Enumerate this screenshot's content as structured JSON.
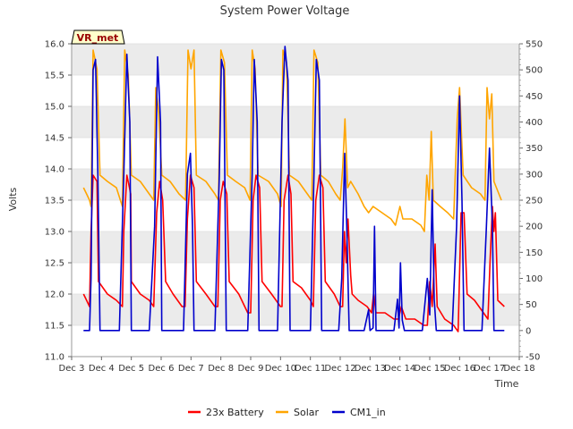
{
  "chart_data": {
    "type": "line",
    "title": "System Power Voltage",
    "site_label": "VR_met",
    "xlabel": "Time",
    "ylabel": "Volts",
    "x_categories": [
      "Dec 3",
      "Dec 4",
      "Dec 5",
      "Dec 6",
      "Dec 7",
      "Dec 8",
      "Dec 9",
      "Dec 10",
      "Dec 11",
      "Dec 12",
      "Dec 13",
      "Dec 14",
      "Dec 15",
      "Dec 16",
      "Dec 17",
      "Dec 18"
    ],
    "xlim": [
      3,
      18
    ],
    "ylim_left": [
      11.0,
      16.0
    ],
    "yticks_left": [
      "11.0",
      "11.5",
      "12.0",
      "12.5",
      "13.0",
      "13.5",
      "14.0",
      "14.5",
      "15.0",
      "15.5",
      "16.0"
    ],
    "ylim_right": [
      -50,
      550
    ],
    "yticks_right": [
      "-50",
      "0",
      "50",
      "100",
      "150",
      "200",
      "250",
      "300",
      "350",
      "400",
      "450",
      "500",
      "550"
    ],
    "grid": "horizontal bands",
    "legend_position": "bottom",
    "series": [
      {
        "name": "23x Battery",
        "color": "#ff0000",
        "axis": "left",
        "points": [
          [
            3.4,
            12.0
          ],
          [
            3.5,
            11.9
          ],
          [
            3.6,
            11.8
          ],
          [
            3.65,
            13.0
          ],
          [
            3.72,
            13.9
          ],
          [
            3.85,
            13.8
          ],
          [
            3.9,
            12.2
          ],
          [
            4.2,
            12.0
          ],
          [
            4.5,
            11.9
          ],
          [
            4.7,
            11.8
          ],
          [
            4.75,
            13.0
          ],
          [
            4.85,
            13.9
          ],
          [
            4.98,
            13.6
          ],
          [
            5.0,
            12.2
          ],
          [
            5.3,
            12.0
          ],
          [
            5.6,
            11.9
          ],
          [
            5.75,
            11.8
          ],
          [
            5.85,
            13.3
          ],
          [
            5.95,
            13.8
          ],
          [
            6.05,
            13.5
          ],
          [
            6.15,
            12.2
          ],
          [
            6.4,
            12.0
          ],
          [
            6.7,
            11.8
          ],
          [
            6.8,
            11.8
          ],
          [
            6.88,
            13.2
          ],
          [
            6.98,
            13.9
          ],
          [
            7.1,
            13.7
          ],
          [
            7.18,
            12.2
          ],
          [
            7.5,
            12.0
          ],
          [
            7.8,
            11.8
          ],
          [
            7.9,
            11.8
          ],
          [
            7.98,
            13.5
          ],
          [
            8.08,
            13.8
          ],
          [
            8.2,
            13.6
          ],
          [
            8.28,
            12.2
          ],
          [
            8.6,
            12.0
          ],
          [
            8.9,
            11.7
          ],
          [
            9.0,
            11.7
          ],
          [
            9.08,
            13.5
          ],
          [
            9.18,
            13.9
          ],
          [
            9.3,
            13.7
          ],
          [
            9.38,
            12.2
          ],
          [
            9.7,
            12.0
          ],
          [
            10.0,
            11.8
          ],
          [
            10.05,
            11.8
          ],
          [
            10.12,
            13.5
          ],
          [
            10.25,
            13.9
          ],
          [
            10.35,
            13.6
          ],
          [
            10.42,
            12.2
          ],
          [
            10.7,
            12.1
          ],
          [
            11.0,
            11.9
          ],
          [
            11.1,
            11.8
          ],
          [
            11.18,
            13.5
          ],
          [
            11.3,
            13.9
          ],
          [
            11.42,
            13.7
          ],
          [
            11.5,
            12.2
          ],
          [
            11.8,
            12.0
          ],
          [
            12.0,
            11.8
          ],
          [
            12.08,
            11.8
          ],
          [
            12.14,
            13.0
          ],
          [
            12.2,
            12.5
          ],
          [
            12.26,
            13.2
          ],
          [
            12.35,
            12.3
          ],
          [
            12.4,
            12.0
          ],
          [
            12.6,
            11.9
          ],
          [
            12.9,
            11.8
          ],
          [
            13.05,
            11.7
          ],
          [
            13.12,
            12.0
          ],
          [
            13.2,
            11.7
          ],
          [
            13.5,
            11.7
          ],
          [
            13.8,
            11.6
          ],
          [
            13.95,
            11.6
          ],
          [
            14.05,
            11.8
          ],
          [
            14.12,
            11.7
          ],
          [
            14.2,
            11.6
          ],
          [
            14.5,
            11.6
          ],
          [
            14.8,
            11.5
          ],
          [
            14.92,
            11.5
          ],
          [
            15.0,
            12.2
          ],
          [
            15.08,
            11.8
          ],
          [
            15.18,
            12.8
          ],
          [
            15.25,
            11.8
          ],
          [
            15.5,
            11.6
          ],
          [
            15.8,
            11.5
          ],
          [
            15.95,
            11.4
          ],
          [
            16.05,
            13.3
          ],
          [
            16.15,
            13.3
          ],
          [
            16.25,
            12.0
          ],
          [
            16.5,
            11.9
          ],
          [
            16.8,
            11.7
          ],
          [
            16.95,
            11.6
          ],
          [
            17.02,
            12.5
          ],
          [
            17.1,
            13.4
          ],
          [
            17.15,
            13.0
          ],
          [
            17.2,
            13.3
          ],
          [
            17.28,
            11.9
          ],
          [
            17.5,
            11.8
          ]
        ]
      },
      {
        "name": "Solar",
        "color": "#ffa500",
        "axis": "left",
        "points": [
          [
            3.4,
            13.7
          ],
          [
            3.5,
            13.6
          ],
          [
            3.6,
            13.5
          ],
          [
            3.65,
            13.4
          ],
          [
            3.72,
            15.9
          ],
          [
            3.85,
            15.6
          ],
          [
            3.95,
            13.9
          ],
          [
            4.2,
            13.8
          ],
          [
            4.5,
            13.7
          ],
          [
            4.7,
            13.4
          ],
          [
            4.78,
            15.9
          ],
          [
            4.9,
            15.5
          ],
          [
            5.0,
            13.9
          ],
          [
            5.3,
            13.8
          ],
          [
            5.6,
            13.6
          ],
          [
            5.75,
            13.5
          ],
          [
            5.82,
            15.3
          ],
          [
            5.92,
            14.9
          ],
          [
            6.02,
            13.9
          ],
          [
            6.3,
            13.8
          ],
          [
            6.6,
            13.6
          ],
          [
            6.82,
            13.5
          ],
          [
            6.9,
            15.9
          ],
          [
            7.0,
            15.6
          ],
          [
            7.1,
            15.9
          ],
          [
            7.18,
            13.9
          ],
          [
            7.5,
            13.8
          ],
          [
            7.8,
            13.6
          ],
          [
            7.92,
            13.5
          ],
          [
            8.0,
            15.9
          ],
          [
            8.12,
            15.7
          ],
          [
            8.22,
            13.9
          ],
          [
            8.5,
            13.8
          ],
          [
            8.8,
            13.7
          ],
          [
            8.98,
            13.5
          ],
          [
            9.05,
            15.9
          ],
          [
            9.15,
            15.6
          ],
          [
            9.25,
            13.9
          ],
          [
            9.6,
            13.8
          ],
          [
            9.9,
            13.6
          ],
          [
            10.02,
            13.4
          ],
          [
            10.08,
            15.9
          ],
          [
            10.2,
            15.7
          ],
          [
            10.3,
            13.9
          ],
          [
            10.6,
            13.8
          ],
          [
            10.9,
            13.6
          ],
          [
            11.05,
            13.5
          ],
          [
            11.12,
            15.9
          ],
          [
            11.25,
            15.7
          ],
          [
            11.35,
            13.9
          ],
          [
            11.6,
            13.8
          ],
          [
            11.85,
            13.6
          ],
          [
            12.0,
            13.5
          ],
          [
            12.08,
            14.0
          ],
          [
            12.16,
            14.8
          ],
          [
            12.25,
            13.7
          ],
          [
            12.35,
            13.8
          ],
          [
            12.6,
            13.6
          ],
          [
            12.8,
            13.4
          ],
          [
            12.95,
            13.3
          ],
          [
            13.1,
            13.4
          ],
          [
            13.4,
            13.3
          ],
          [
            13.7,
            13.2
          ],
          [
            13.85,
            13.1
          ],
          [
            14.0,
            13.4
          ],
          [
            14.1,
            13.2
          ],
          [
            14.4,
            13.2
          ],
          [
            14.7,
            13.1
          ],
          [
            14.82,
            13.0
          ],
          [
            14.9,
            13.9
          ],
          [
            14.98,
            13.5
          ],
          [
            15.05,
            14.6
          ],
          [
            15.12,
            13.5
          ],
          [
            15.35,
            13.4
          ],
          [
            15.6,
            13.3
          ],
          [
            15.8,
            13.2
          ],
          [
            15.92,
            14.8
          ],
          [
            16.0,
            15.3
          ],
          [
            16.12,
            13.9
          ],
          [
            16.4,
            13.7
          ],
          [
            16.7,
            13.6
          ],
          [
            16.85,
            13.5
          ],
          [
            16.92,
            15.3
          ],
          [
            17.0,
            14.8
          ],
          [
            17.08,
            15.2
          ],
          [
            17.15,
            13.8
          ],
          [
            17.4,
            13.5
          ]
        ]
      },
      {
        "name": "CM1_in",
        "color": "#0000cc",
        "axis": "right",
        "points": [
          [
            3.4,
            0
          ],
          [
            3.6,
            0
          ],
          [
            3.65,
            100
          ],
          [
            3.72,
            500
          ],
          [
            3.8,
            520
          ],
          [
            3.88,
            300
          ],
          [
            3.95,
            0
          ],
          [
            4.6,
            0
          ],
          [
            4.75,
            300
          ],
          [
            4.85,
            530
          ],
          [
            4.95,
            400
          ],
          [
            5.0,
            0
          ],
          [
            5.6,
            0
          ],
          [
            5.78,
            200
          ],
          [
            5.88,
            525
          ],
          [
            5.98,
            400
          ],
          [
            6.02,
            0
          ],
          [
            6.75,
            0
          ],
          [
            6.88,
            300
          ],
          [
            6.98,
            340
          ],
          [
            7.05,
            200
          ],
          [
            7.1,
            0
          ],
          [
            7.8,
            0
          ],
          [
            7.95,
            300
          ],
          [
            8.02,
            520
          ],
          [
            8.1,
            500
          ],
          [
            8.18,
            0
          ],
          [
            8.9,
            0
          ],
          [
            9.05,
            300
          ],
          [
            9.12,
            520
          ],
          [
            9.22,
            400
          ],
          [
            9.28,
            0
          ],
          [
            9.9,
            0
          ],
          [
            10.05,
            400
          ],
          [
            10.15,
            545
          ],
          [
            10.25,
            480
          ],
          [
            10.32,
            0
          ],
          [
            11.0,
            0
          ],
          [
            11.12,
            300
          ],
          [
            11.2,
            520
          ],
          [
            11.3,
            480
          ],
          [
            11.38,
            0
          ],
          [
            11.95,
            0
          ],
          [
            12.05,
            100
          ],
          [
            12.15,
            340
          ],
          [
            12.22,
            200
          ],
          [
            12.3,
            0
          ],
          [
            12.8,
            0
          ],
          [
            12.95,
            40
          ],
          [
            13.0,
            0
          ],
          [
            13.1,
            5
          ],
          [
            13.15,
            200
          ],
          [
            13.2,
            0
          ],
          [
            13.8,
            0
          ],
          [
            13.92,
            60
          ],
          [
            13.97,
            5
          ],
          [
            14.02,
            130
          ],
          [
            14.08,
            20
          ],
          [
            14.15,
            0
          ],
          [
            14.75,
            0
          ],
          [
            14.92,
            100
          ],
          [
            15.0,
            30
          ],
          [
            15.08,
            270
          ],
          [
            15.15,
            60
          ],
          [
            15.22,
            0
          ],
          [
            15.75,
            0
          ],
          [
            15.9,
            200
          ],
          [
            16.0,
            450
          ],
          [
            16.08,
            250
          ],
          [
            16.15,
            0
          ],
          [
            16.75,
            0
          ],
          [
            16.9,
            200
          ],
          [
            17.0,
            350
          ],
          [
            17.1,
            200
          ],
          [
            17.15,
            0
          ],
          [
            17.5,
            0
          ]
        ]
      }
    ]
  }
}
